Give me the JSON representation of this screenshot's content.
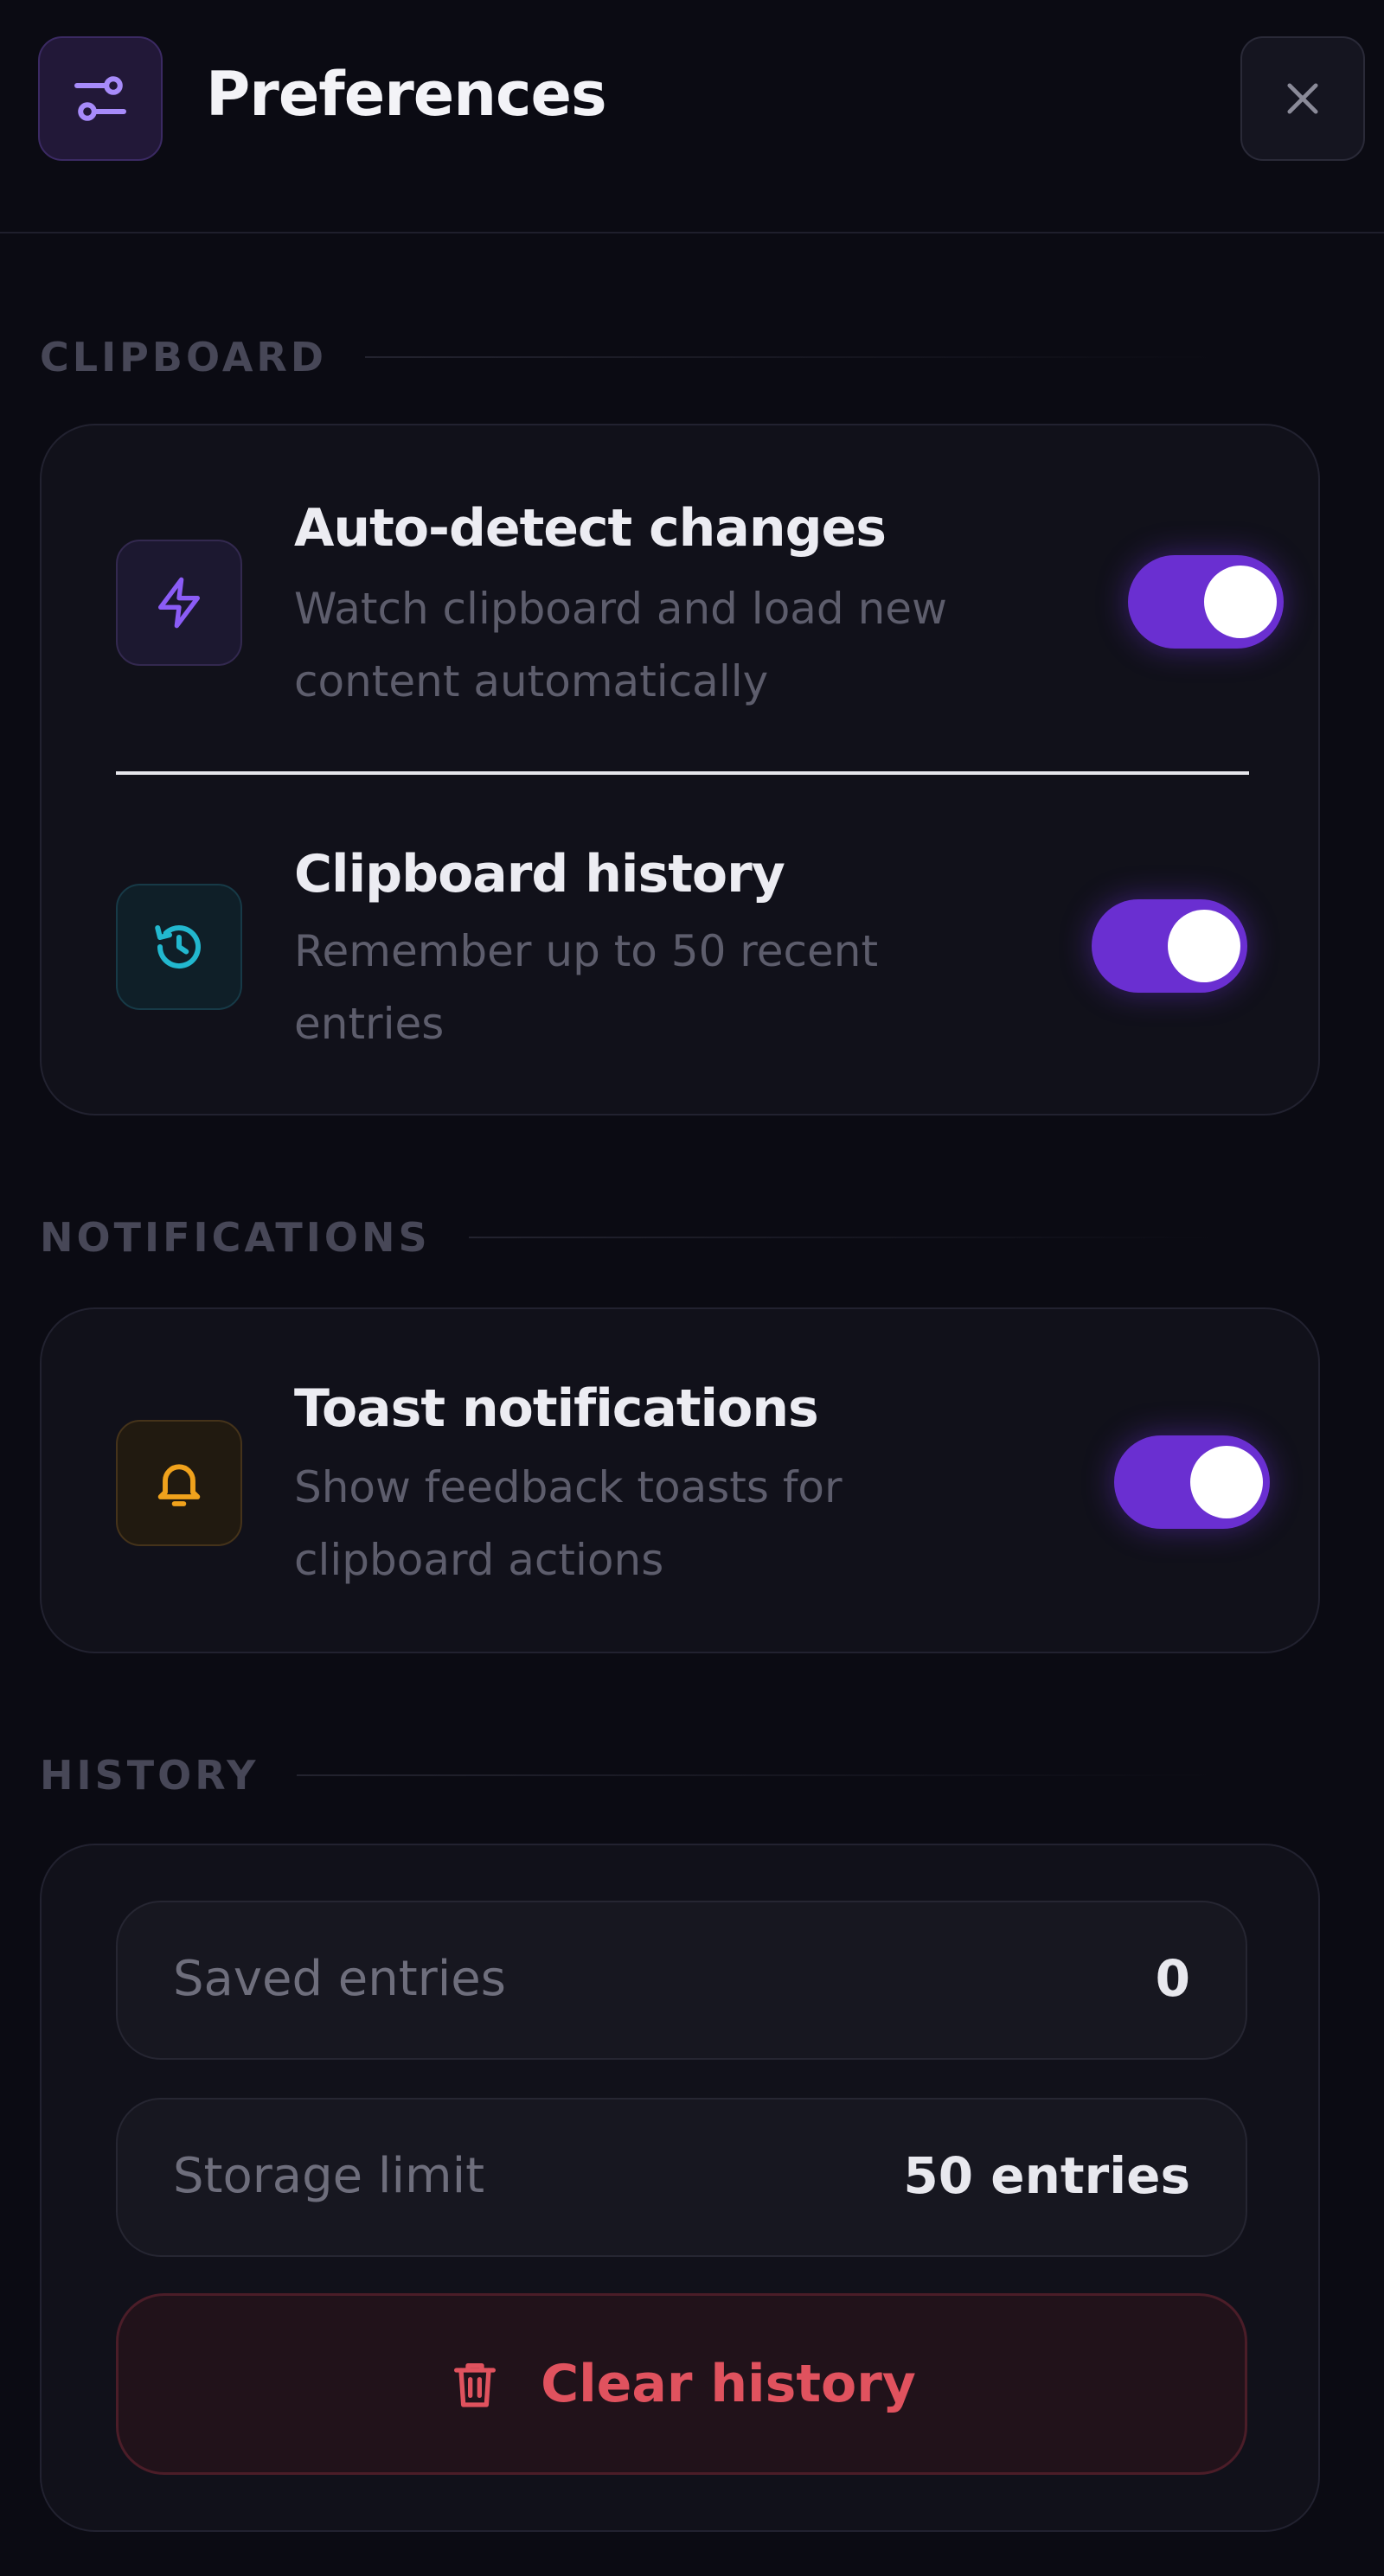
{
  "header": {
    "title": "Preferences",
    "icon": "sliders-icon",
    "close_icon": "close-icon"
  },
  "colors": {
    "accent": "#6a2fd1",
    "danger": "#e0525e",
    "background": "#0b0b13"
  },
  "sections": {
    "clipboard": {
      "title": "CLIPBOARD",
      "items": [
        {
          "title": "Auto-detect changes",
          "description": "Watch clipboard and load new content automatically",
          "icon": "lightning-icon",
          "enabled": true
        },
        {
          "title": "Clipboard history",
          "description": "Remember up to 50 recent entries",
          "icon": "history-icon",
          "enabled": true
        }
      ]
    },
    "notifications": {
      "title": "NOTIFICATIONS",
      "items": [
        {
          "title": "Toast notifications",
          "description": "Show feedback toasts for clipboard actions",
          "icon": "bell-icon",
          "enabled": true
        }
      ]
    },
    "history": {
      "title": "HISTORY",
      "stats": [
        {
          "label": "Saved entries",
          "value": "0"
        },
        {
          "label": "Storage limit",
          "value": "50 entries"
        }
      ],
      "clear_label": "Clear history",
      "clear_icon": "trash-icon"
    }
  }
}
